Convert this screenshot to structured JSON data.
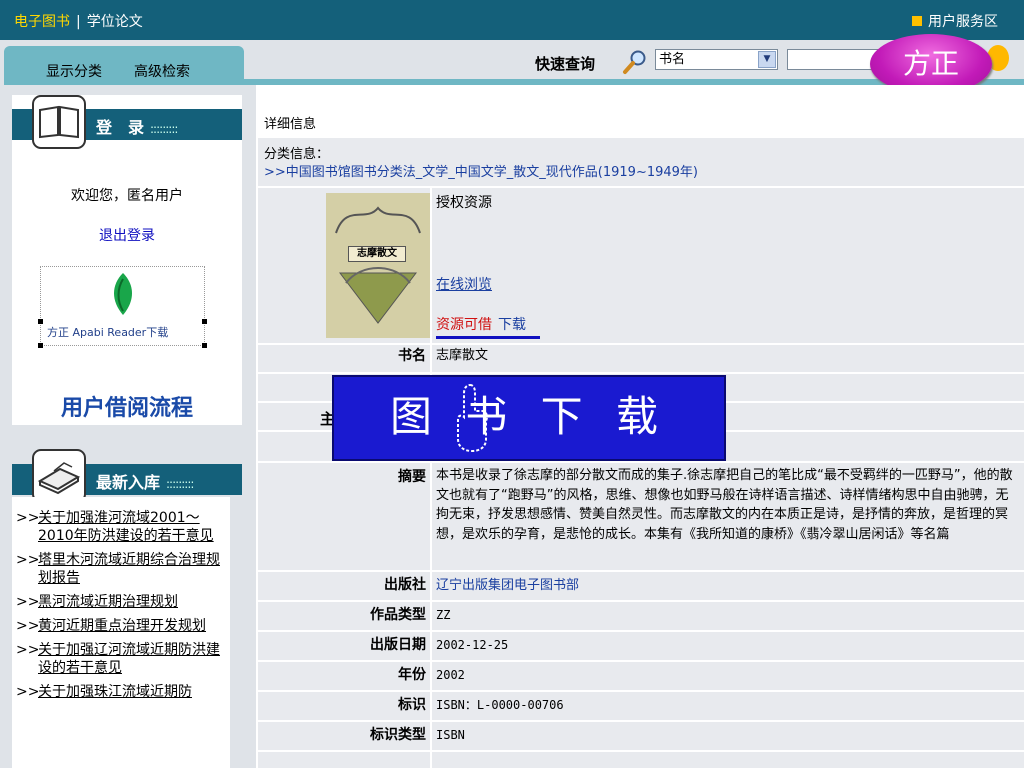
{
  "topbar": {
    "ebook": "电子图书",
    "separator": "|",
    "thesis": "学位论文",
    "service": "用户服务区"
  },
  "toolbar": {
    "show_category": "显示分类",
    "advanced_search": "高级检索",
    "quick_search": "快速查询",
    "search_field": "书名",
    "fangzheng": "方正"
  },
  "sidebar": {
    "login_header": "登　录",
    "header_dots": ":::::::::",
    "welcome": "欢迎您，匿名用户",
    "logout": "退出登录",
    "apabi": "方正 Apabi Reader下载",
    "borrow_process": "用户借阅流程",
    "latest_header": "最新入库",
    "latest_marker": ">>",
    "latest": [
      "关于加强淮河流域2001～2010年防洪建设的若干意见",
      "塔里木河流域近期综合治理规划报告",
      "黑河流域近期治理规划",
      "黄河近期重点治理开发规划",
      "关于加强辽河流域近期防洪建设的若干意见",
      "关于加强珠江流域近期防"
    ]
  },
  "main": {
    "detail_title": "详细信息",
    "category_label": "分类信息：",
    "category_path": ">>中国图书馆图书分类法_文学_中国文学_散文_现代作品(1919~1949年)",
    "cover_title": "志摩散文",
    "authorized": "授权资源",
    "online_browse": "在线浏览",
    "available": "资源可借",
    "download": "下载",
    "fields": {
      "title_k": "书名",
      "title_v": "志摩散文",
      "author_k": "主",
      "abstract_k": "摘要",
      "abstract_v": "本书是收录了徐志摩的部分散文而成的集子.徐志摩把自己的笔比成“最不受羁绊的一匹野马”，他的散文也就有了“跑野马”的风格，思维、想像也如野马般在诗样语言描述、诗样情绪构思中自由驰骋，无拘无束，抒发思想感情、赞美自然灵性。而志摩散文的内在本质正是诗，是抒情的奔放，是哲理的冥想，是欢乐的孕育，是悲怆的成长。本集有《我所知道的康桥》《翡冷翠山居闲话》等名篇",
      "publisher_k": "出版社",
      "publisher_v": "辽宁出版集团电子图书部",
      "type_k": "作品类型",
      "type_v": "ZZ",
      "date_k": "出版日期",
      "date_v": "2002-12-25",
      "year_k": "年份",
      "year_v": "2002",
      "id_k": "标识",
      "id_v": "ISBN：L-0000-00706",
      "idtype_k": "标识类型",
      "idtype_v": "ISBN"
    }
  },
  "banner": {
    "text": "图 书 下 载"
  }
}
